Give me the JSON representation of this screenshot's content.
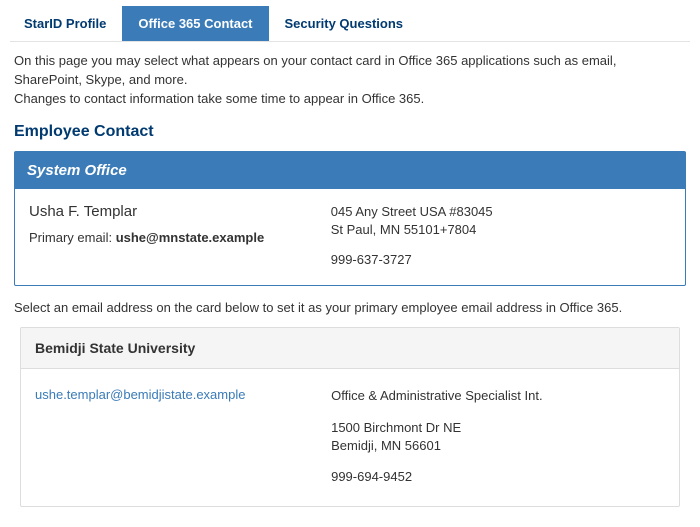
{
  "tabs": {
    "items": [
      {
        "label": "StarID Profile"
      },
      {
        "label": "Office 365 Contact"
      },
      {
        "label": "Security Questions"
      }
    ],
    "activeIndex": 1
  },
  "intro": {
    "line1": "On this page you may select what appears on your contact card in Office 365 applications such as email, SharePoint, Skype, and more.",
    "line2": "Changes to contact information take some time to appear in Office 365."
  },
  "section_title": "Employee Contact",
  "primary_card": {
    "header": "System Office",
    "name": "Usha F. Templar",
    "primary_email_label": "Primary email: ",
    "primary_email_value": "ushe@mnstate.example",
    "address_line1": "045 Any Street USA #83045",
    "address_line2": "St Paul, MN 55101+7804",
    "phone": "999-637-3727"
  },
  "instruction": "Select an email address on the card below to set it as your primary employee email address in Office 365.",
  "secondary_card": {
    "header": "Bemidji State University",
    "email": "ushe.templar@bemidjistate.example",
    "role": "Office & Administrative Specialist Int.",
    "address_line1": "1500 Birchmont Dr NE",
    "address_line2": "Bemidji, MN 56601",
    "phone": "999-694-9452"
  }
}
